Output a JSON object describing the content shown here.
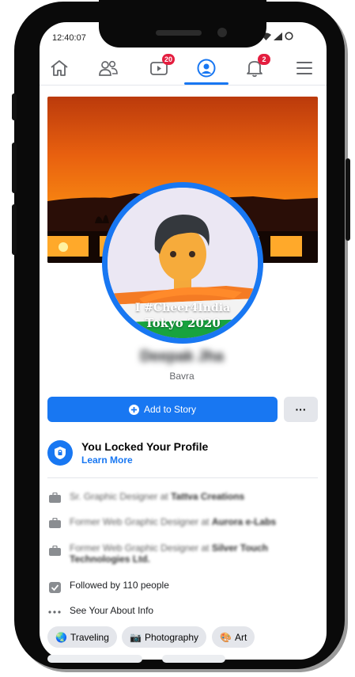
{
  "status_bar": {
    "time": "12:40:07"
  },
  "nav": {
    "watch_badge": "20",
    "notifications_badge": "2"
  },
  "profile": {
    "frame_line1": "I #Cheer4India",
    "frame_line2": "Tokyo 2020",
    "name": "Deepak Jha",
    "location": "Bavra"
  },
  "actions": {
    "add_story_label": "Add to Story",
    "more_label": "···"
  },
  "lock_notice": {
    "title": "You Locked Your Profile",
    "link": "Learn More"
  },
  "about": {
    "work1_role": "Sr. Graphic Designer at",
    "work1_company": "Tattva Creations",
    "work2_role": "Former Web Graphic Designer at",
    "work2_company": "Aurora e-Labs",
    "work3_role": "Former Web Graphic Designer at",
    "work3_company": "Silver Touch Technologies Ltd.",
    "followed_by": "Followed by 110 people",
    "see_about": "See Your About Info"
  },
  "interests": [
    {
      "emoji": "🌏",
      "label": "Traveling"
    },
    {
      "emoji": "📷",
      "label": "Photography"
    },
    {
      "emoji": "🎨",
      "label": "Art"
    }
  ],
  "colors": {
    "accent": "#1877f2",
    "badge": "#e41e3f",
    "chip_bg": "#e4e6eb"
  }
}
